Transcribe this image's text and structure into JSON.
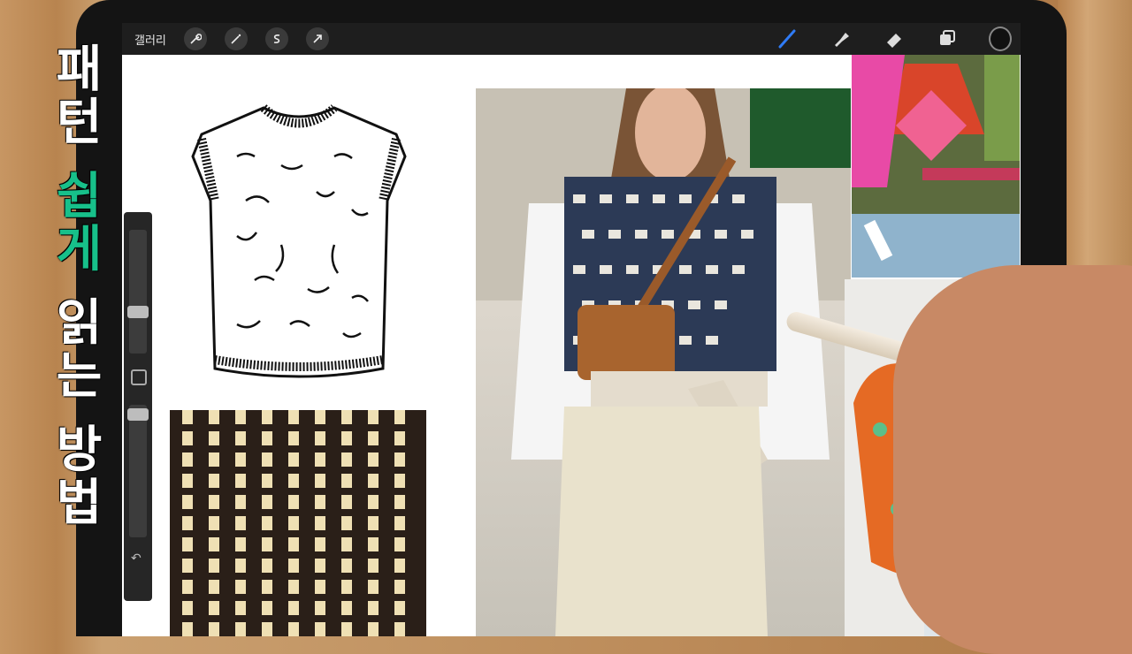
{
  "toolbar": {
    "gallery_label": "갤러리",
    "left_tools": [
      "wrench-icon",
      "magic-wand-icon",
      "selection-icon",
      "move-arrow-icon"
    ],
    "right_tools": [
      "brush-icon",
      "smudge-icon",
      "eraser-icon",
      "layers-icon",
      "color-icon"
    ],
    "accent_color": "#2f7bf5"
  },
  "overlay_title": {
    "line_prefix": "패턴 ",
    "highlight": "쉽게",
    "line_suffix": " 읽는 방법",
    "highlight_color": "#17c08a"
  },
  "side_panel": {
    "undo_symbol": "↶"
  },
  "images": [
    {
      "name": "vest-flat-sketch"
    },
    {
      "name": "knit-swatch"
    },
    {
      "name": "runway-photo"
    },
    {
      "name": "argyle-sweater-photo"
    },
    {
      "name": "orange-knit-photo"
    }
  ]
}
